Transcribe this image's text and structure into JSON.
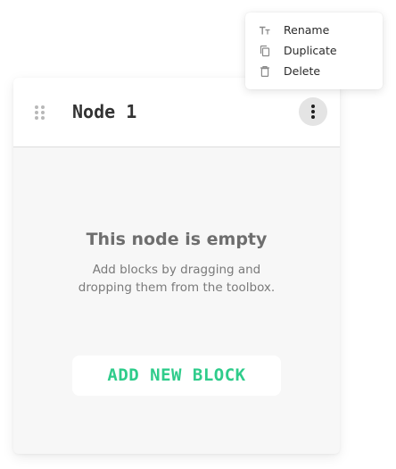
{
  "node": {
    "title": "Node 1",
    "empty_title": "This node is empty",
    "empty_description": "Add blocks by dragging and dropping them from the toolbox.",
    "add_button_label": "ADD NEW BLOCK"
  },
  "context_menu": {
    "items": [
      {
        "label": "Rename",
        "icon": "text-format-icon"
      },
      {
        "label": "Duplicate",
        "icon": "copy-icon"
      },
      {
        "label": "Delete",
        "icon": "trash-icon"
      }
    ]
  },
  "colors": {
    "accent": "#2fcc8b",
    "card_background": "#f7f7f7",
    "title_text": "#333333",
    "muted_text": "#6e6e6e"
  }
}
